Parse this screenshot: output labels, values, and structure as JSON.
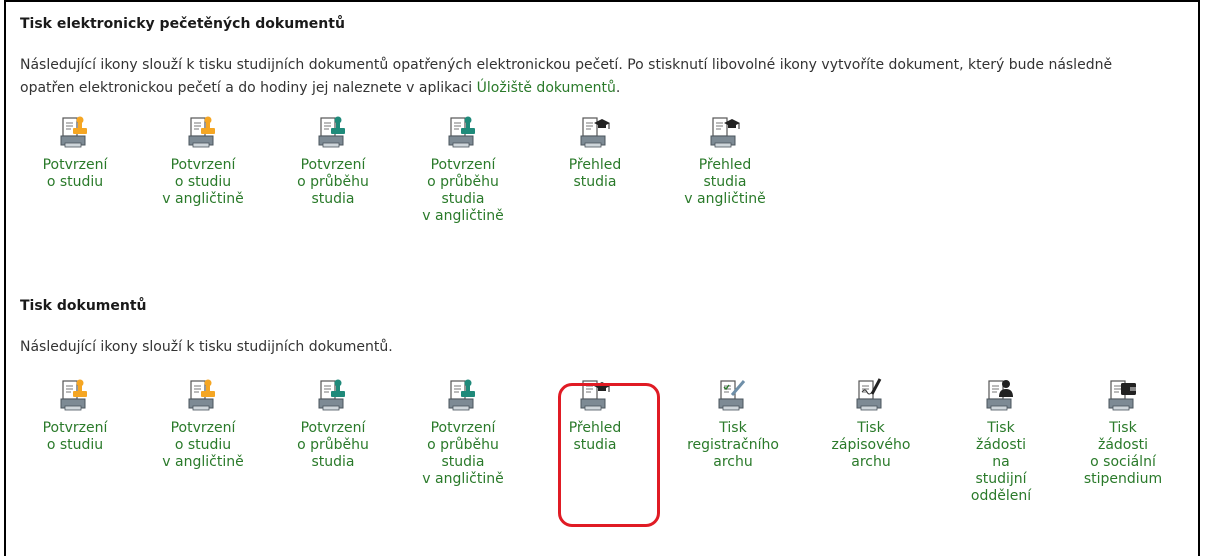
{
  "section_seal": {
    "title": "Tisk elektronicky pečetěných dokumentů",
    "desc_text": "Následující ikony slouží k tisku studijních dokumentů opatřených elektronickou pečetí. Po stisknutí libovolné ikony vytvoříte dokument, který bude následně opatřen elektronickou pečetí a do hodiny jej naleznete v aplikaci ",
    "desc_link": "Úložiště dokumentů",
    "desc_end": ".",
    "items": [
      {
        "label": "Potvrzení\no studiu",
        "icon": "printer-orange-stamp-icon"
      },
      {
        "label": "Potvrzení\no studiu\nv angličtině",
        "icon": "printer-orange-stamp-icon"
      },
      {
        "label": "Potvrzení\no průběhu\nstudia",
        "icon": "printer-teal-stamp-icon"
      },
      {
        "label": "Potvrzení\no průběhu\nstudia\nv angličtině",
        "icon": "printer-teal-stamp-icon"
      },
      {
        "label": "Přehled\nstudia",
        "icon": "printer-graduation-cap-icon"
      },
      {
        "label": "Přehled\nstudia\nv angličtině",
        "icon": "printer-graduation-cap-icon"
      }
    ]
  },
  "section_print": {
    "title": "Tisk dokumentů",
    "desc_text": "Následující ikony slouží k tisku studijních dokumentů.",
    "items": [
      {
        "label": "Potvrzení\no studiu",
        "icon": "printer-orange-stamp-icon"
      },
      {
        "label": "Potvrzení\no studiu\nv angličtině",
        "icon": "printer-orange-stamp-icon"
      },
      {
        "label": "Potvrzení\no průběhu\nstudia",
        "icon": "printer-teal-stamp-icon"
      },
      {
        "label": "Potvrzení\no průběhu\nstudia\nv angličtině",
        "icon": "printer-teal-stamp-icon"
      },
      {
        "label": "Přehled\nstudia",
        "icon": "printer-graduation-cap-icon"
      },
      {
        "label": "Tisk\nregistračního\narchu",
        "icon": "printer-checklist-pen-icon"
      },
      {
        "label": "Tisk\nzápisového\narchu",
        "icon": "printer-signature-pen-icon"
      },
      {
        "label": "Tisk\nžádosti\nna\nstudijní\noddělení",
        "icon": "printer-person-icon"
      },
      {
        "label": "Tisk\nžádosti\no sociální\nstipendium",
        "icon": "printer-wallet-icon"
      }
    ]
  },
  "colors": {
    "link": "#2a7a2a",
    "highlight": "#e01b24",
    "orange": "#f5a623",
    "teal": "#1f8a7a"
  }
}
